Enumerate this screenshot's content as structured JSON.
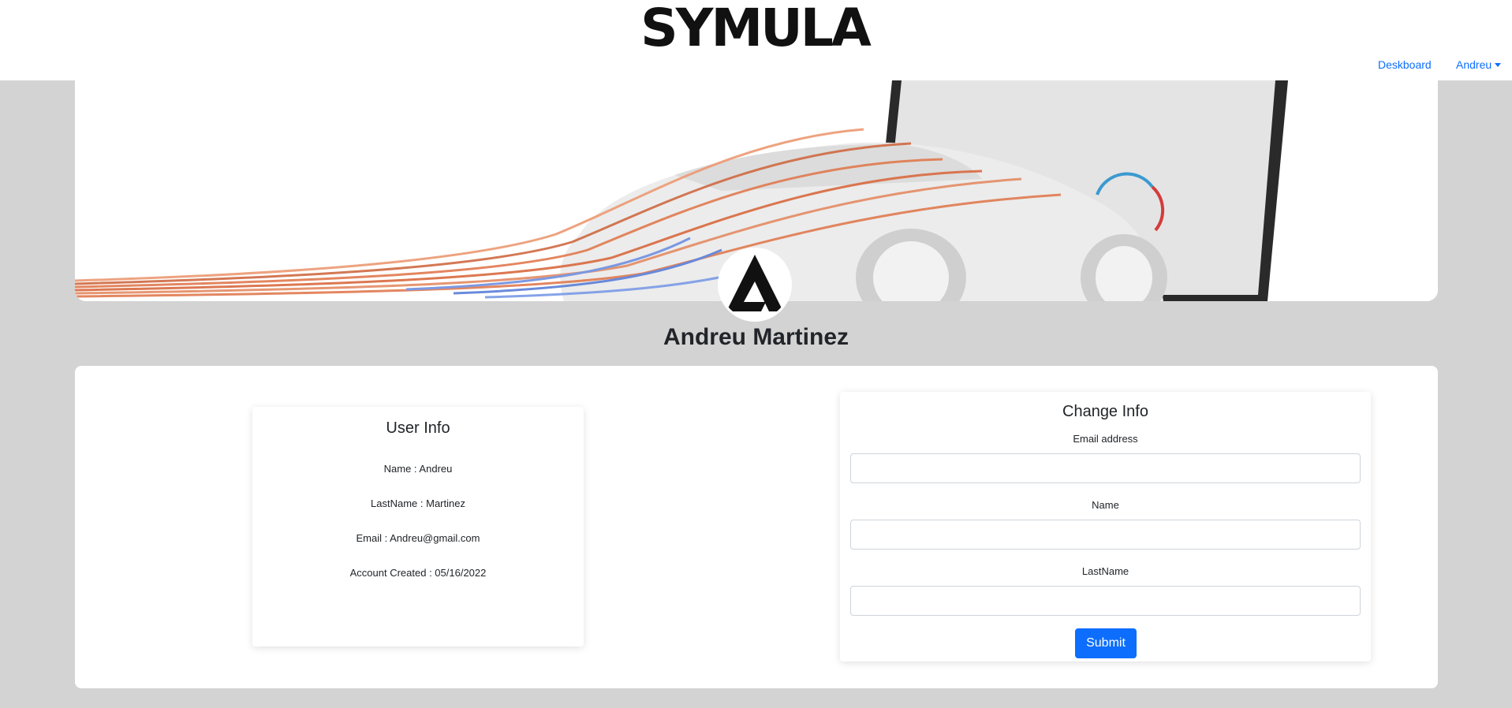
{
  "brand": {
    "logo_text": "SYMULA"
  },
  "nav": {
    "dashboard_label": "Deskboard",
    "user_label": "Andreu"
  },
  "profile": {
    "full_name": "Andreu Martinez"
  },
  "user_info": {
    "title": "User Info",
    "name_line": "Name : Andreu",
    "lastname_line": "LastName : Martinez",
    "email_line": "Email : Andreu@gmail.com",
    "created_line": "Account Created : 05/16/2022"
  },
  "change_info": {
    "title": "Change Info",
    "email_label": "Email address",
    "email_value": "",
    "name_label": "Name",
    "name_value": "",
    "lastname_label": "LastName",
    "lastname_value": "",
    "submit_label": "Submit"
  },
  "colors": {
    "accent": "#0d6efd",
    "page_bg": "#d3d3d3",
    "streamline": "#e07a4f"
  },
  "icons": {
    "avatar": "symula-delta-logo-icon",
    "dropdown": "caret-down-icon"
  }
}
